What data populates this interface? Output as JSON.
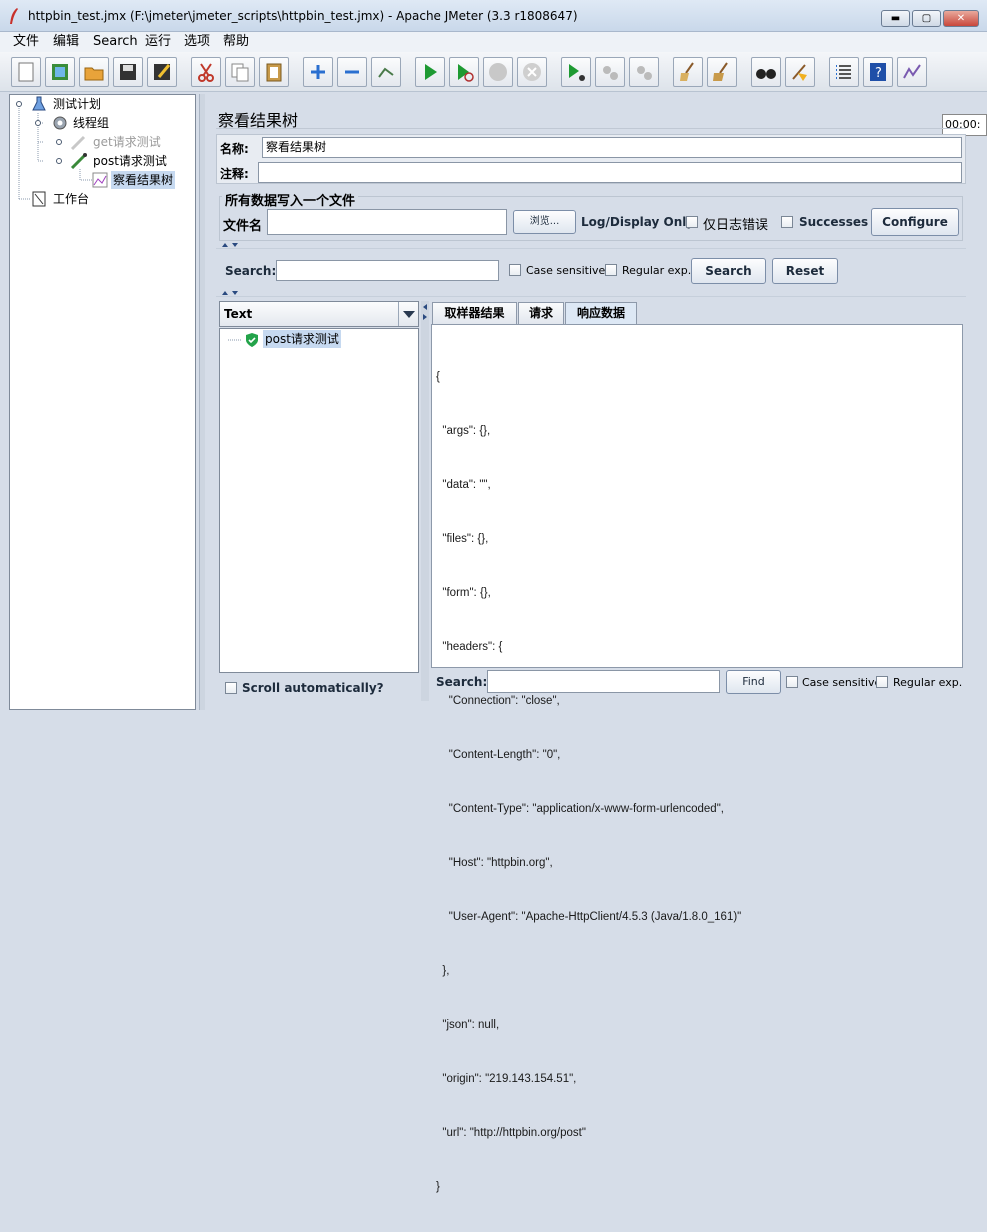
{
  "window": {
    "title": "httpbin_test.jmx (F:\\jmeter\\jmeter_scripts\\httpbin_test.jmx) - Apache JMeter (3.3 r1808647)",
    "minimize": "▬",
    "maximize": "▢",
    "close": "✕"
  },
  "menu": [
    "文件",
    "编辑",
    "Search",
    "运行",
    "选项",
    "帮助"
  ],
  "toolbar": {
    "timer": "00:00:"
  },
  "tree": {
    "plan": "测试计划",
    "thread_group": "线程组",
    "get_sampler": "get请求测试",
    "post_sampler": "post请求测试",
    "listener": "察看结果树",
    "workbench": "工作台"
  },
  "listener": {
    "title": "察看结果树",
    "name_label": "名称:",
    "name_value": "察看结果树",
    "comment_label": "注释:",
    "comment_value": "",
    "file_group": "所有数据写入一个文件",
    "filename_label": "文件名",
    "filename_value": "",
    "browse": "浏览...",
    "log_display": "Log/Display Only:",
    "errors_only": "仅日志错误",
    "successes": "Successes",
    "configure": "Configure"
  },
  "search": {
    "label": "Search:",
    "value": "",
    "case_sensitive": "Case sensitive",
    "regex": "Regular exp.",
    "search_btn": "Search",
    "reset_btn": "Reset"
  },
  "results": {
    "renderer": "Text",
    "samples": [
      "post请求测试"
    ],
    "scroll_auto": "Scroll automatically?"
  },
  "tabs": [
    "取样器结果",
    "请求",
    "响应数据"
  ],
  "active_tab": 2,
  "response_lines": [
    "{",
    "  \"args\": {},",
    "  \"data\": \"\",",
    "  \"files\": {},",
    "  \"form\": {},",
    "  \"headers\": {",
    "    \"Connection\": \"close\",",
    "    \"Content-Length\": \"0\",",
    "    \"Content-Type\": \"application/x-www-form-urlencoded\",",
    "    \"Host\": \"httpbin.org\",",
    "    \"User-Agent\": \"Apache-HttpClient/4.5.3 (Java/1.8.0_161)\"",
    "  },",
    "  \"json\": null,",
    "  \"origin\": \"219.143.154.51\",",
    "  \"url\": \"http://httpbin.org/post\"",
    "}"
  ],
  "bottom_search": {
    "label": "Search:",
    "value": "",
    "find": "Find",
    "case_sensitive": "Case sensitive",
    "regex": "Regular exp."
  }
}
